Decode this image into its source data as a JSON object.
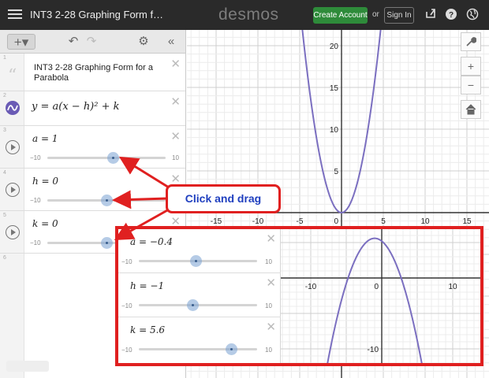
{
  "topbar": {
    "title": "INT3 2-28 Graphing Form f…",
    "brand": "desmos",
    "create_account": "Create Account",
    "or": "or",
    "sign_in": "Sign In",
    "icons": [
      "share-icon",
      "help-icon",
      "globe-icon"
    ]
  },
  "toolbar": {
    "add": "+▾",
    "undo": "↶",
    "redo": "↷",
    "settings": "⚙",
    "collapse": "«"
  },
  "expressions": [
    {
      "num": "1",
      "type": "note",
      "text": "INT3 2-28 Graphing Form for a Parabola"
    },
    {
      "num": "2",
      "type": "formula",
      "text": "y = a(x − h)² + k"
    },
    {
      "num": "3",
      "type": "slider",
      "var": "a",
      "value": "1",
      "eq": "a = 1",
      "min": "−10",
      "max": "10",
      "fraction": 0.55
    },
    {
      "num": "4",
      "type": "slider",
      "var": "h",
      "value": "0",
      "eq": "h = 0",
      "min": "−10",
      "max": "10",
      "fraction": 0.5
    },
    {
      "num": "5",
      "type": "slider",
      "var": "k",
      "value": "0",
      "eq": "k = 0",
      "min": "−10",
      "max": "10",
      "fraction": 0.5
    },
    {
      "num": "6",
      "type": "empty"
    }
  ],
  "graph": {
    "x_ticks": [
      "-15",
      "-10",
      "-5",
      "0",
      "5",
      "10",
      "15"
    ],
    "y_ticks": [
      "20",
      "15",
      "10",
      "5"
    ],
    "curve_color": "#7b6fc0",
    "tools": [
      "wrench-icon",
      "zoom-in-icon",
      "zoom-out-icon",
      "home-icon"
    ],
    "zoom_in": "+",
    "zoom_out": "−"
  },
  "callout": {
    "text": "Click and drag"
  },
  "inset": {
    "sliders": [
      {
        "eq": "a = −0.4",
        "min": "−10",
        "max": "10",
        "fraction": 0.48
      },
      {
        "eq": "h = −1",
        "min": "−10",
        "max": "10",
        "fraction": 0.45
      },
      {
        "eq": "k = 5.6",
        "min": "−10",
        "max": "10",
        "fraction": 0.78
      }
    ],
    "x_ticks": [
      "-10",
      "0",
      "10"
    ],
    "y_ticks": [
      "-10"
    ]
  },
  "colors": {
    "accent": "#e02020",
    "callout_text": "#1f3fbf",
    "create_green": "#2e8b3a"
  }
}
